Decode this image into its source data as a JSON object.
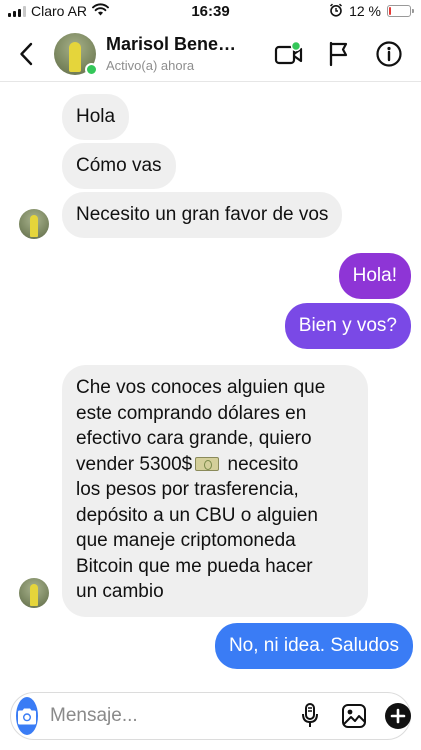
{
  "status_bar": {
    "carrier": "Claro AR",
    "time": "16:39",
    "battery_text": "12 %",
    "battery_level": 0.12,
    "battery_color": "#e53935",
    "icons": [
      "signal-icon",
      "wifi-icon",
      "alarm-icon",
      "battery-icon"
    ]
  },
  "header": {
    "contact_name": "Marisol Bene…",
    "contact_status": "Activo(a) ahora",
    "online_color": "#34c759",
    "icons": [
      "back-icon",
      "video-call-icon",
      "flag-icon",
      "info-icon"
    ]
  },
  "messages": [
    {
      "direction": "incoming",
      "text": "Hola"
    },
    {
      "direction": "incoming",
      "text": "Cómo vas"
    },
    {
      "direction": "incoming",
      "text": "Necesito un gran favor de vos"
    },
    {
      "direction": "outgoing",
      "text": "Hola!",
      "color": "#8e35d6"
    },
    {
      "direction": "outgoing",
      "text": "Bien y vos?",
      "color": "#7a49e6"
    },
    {
      "direction": "incoming",
      "lines": [
        "Che vos conoces alguien que",
        "este comprando dólares en",
        "efectivo cara grande, quiero",
        "vender 5300$",
        "necesito",
        "los pesos por trasferencia,",
        "depósito a un CBU o alguien",
        "que maneje criptomoneda",
        "Bitcoin que me pueda hacer",
        "un cambio"
      ],
      "emoji": "money-bill-icon"
    },
    {
      "direction": "outgoing",
      "text": "No, ni idea. Saludos",
      "color": "#3a7cf5"
    }
  ],
  "composer": {
    "placeholder": "Mensaje...",
    "icons": [
      "camera-icon",
      "microphone-icon",
      "gallery-icon",
      "add-icon"
    ],
    "accent": "#3a7cf5"
  }
}
